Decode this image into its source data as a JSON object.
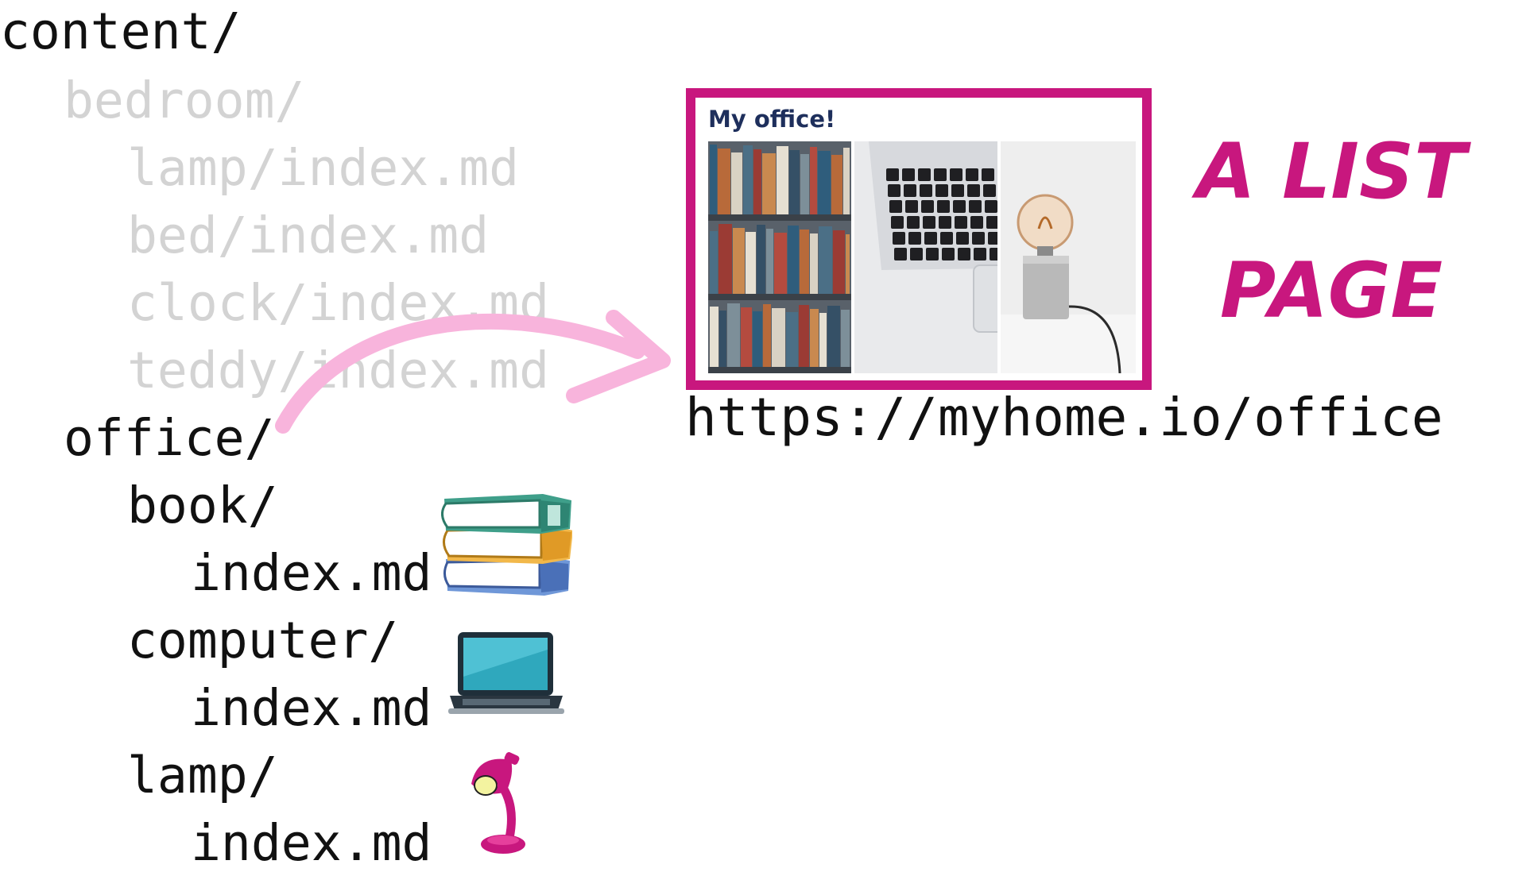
{
  "tree": {
    "root": "content/",
    "bedroom": {
      "folder": "bedroom/",
      "files": [
        "lamp/index.md",
        "bed/index.md",
        "clock/index.md",
        "teddy/index.md"
      ]
    },
    "office": {
      "folder": "office/",
      "items": [
        {
          "folder": "book/",
          "file": "index.md",
          "icon": "books-icon"
        },
        {
          "folder": "computer/",
          "file": "index.md",
          "icon": "laptop-icon"
        },
        {
          "folder": "lamp/",
          "file": "index.md",
          "icon": "desk-lamp-icon"
        }
      ]
    }
  },
  "page_preview": {
    "title": "My office!",
    "images": [
      "bookshelf-image",
      "laptop-keyboard-image",
      "light-bulb-lamp-image"
    ]
  },
  "url": "https://myhome.io/office",
  "heading": {
    "line1": "A LIST",
    "line2": "PAGE"
  },
  "colors": {
    "accent": "#c8177e",
    "arrow": "#f8b4dc",
    "faded_text": "#d3d3d3",
    "text": "#111111",
    "preview_title": "#1e2f5c"
  }
}
